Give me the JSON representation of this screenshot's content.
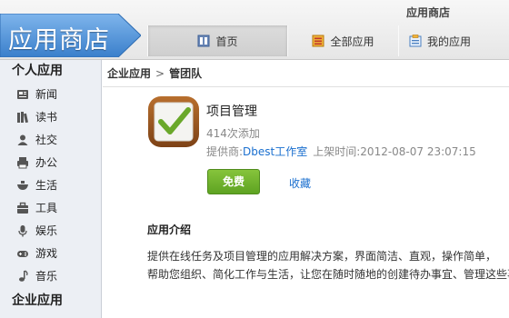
{
  "window_title": "应用商店",
  "logo_text": "应用商店",
  "nav": [
    {
      "label": "首页",
      "icon": "home-icon",
      "active": true
    },
    {
      "label": "全部应用",
      "icon": "all-apps-icon",
      "active": false
    },
    {
      "label": "我的应用",
      "icon": "my-apps-icon",
      "active": false
    }
  ],
  "sidebar": {
    "personal_header": "个人应用",
    "items": [
      {
        "label": "新闻",
        "icon": "news-icon"
      },
      {
        "label": "读书",
        "icon": "book-icon"
      },
      {
        "label": "社交",
        "icon": "social-icon"
      },
      {
        "label": "办公",
        "icon": "printer-icon"
      },
      {
        "label": "生活",
        "icon": "life-icon"
      },
      {
        "label": "工具",
        "icon": "tools-icon"
      },
      {
        "label": "娱乐",
        "icon": "entertainment-icon"
      },
      {
        "label": "游戏",
        "icon": "gamepad-icon"
      },
      {
        "label": "音乐",
        "icon": "music-icon"
      }
    ],
    "enterprise_header": "企业应用"
  },
  "breadcrumb": {
    "parent": "企业应用",
    "separator": ">",
    "current": "管团队"
  },
  "app": {
    "name": "项目管理",
    "installs": "414次添加",
    "provider_label": "提供商:",
    "provider": "Dbest工作室",
    "date_label": "上架时间:",
    "date": "2012-08-07 23:07:15",
    "free_label": "免费",
    "favorite_label": "收藏",
    "icon": "checkmark-app-icon"
  },
  "intro": {
    "title": "应用介绍",
    "lines": [
      "提供在线任务及项目管理的应用解决方案，界面简洁、直观，操作简单，",
      "帮助您组织、简化工作与生活，让您在随时随地的创建待办事宜、管理这些事"
    ]
  },
  "colors": {
    "accent": "#1a6fcf",
    "logo_blue": "#4a8fd6",
    "free_green": "#6fb12c",
    "sidebar_bg": "#eceff4"
  }
}
